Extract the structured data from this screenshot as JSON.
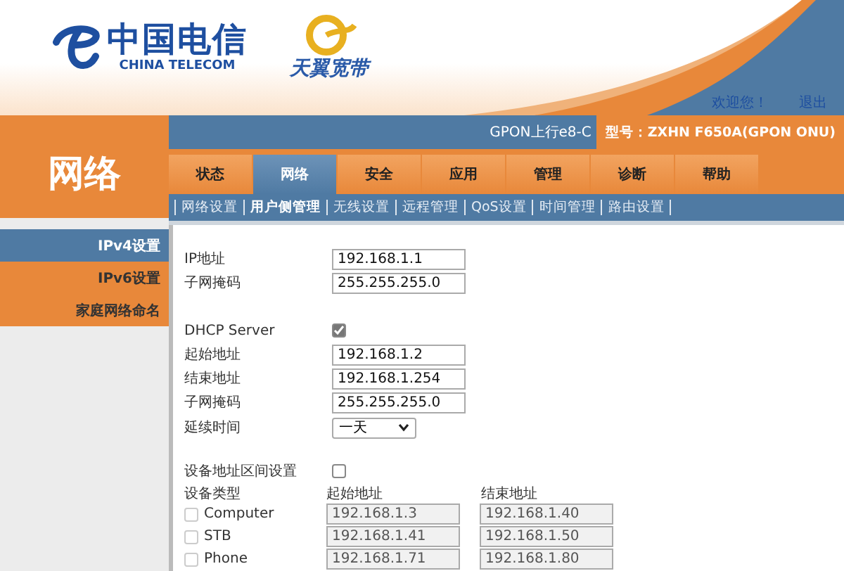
{
  "header": {
    "brand_chinese": "中国电信",
    "brand_english": "CHINA TELECOM",
    "product": "天翼宽带",
    "links": [
      "欢迎您！",
      "退出"
    ]
  },
  "info_bar": {
    "connection": "GPON上行e8-C",
    "model": "型号：ZXHN F650A(GPON ONU)"
  },
  "section_title": "网络",
  "tabs": [
    {
      "label": "状态",
      "selected": false
    },
    {
      "label": "网络",
      "selected": true
    },
    {
      "label": "安全",
      "selected": false
    },
    {
      "label": "应用",
      "selected": false
    },
    {
      "label": "管理",
      "selected": false
    },
    {
      "label": "诊断",
      "selected": false
    },
    {
      "label": "帮助",
      "selected": false
    }
  ],
  "sub_tabs": [
    {
      "label": "网络设置",
      "selected": false
    },
    {
      "label": "用户侧管理",
      "selected": true
    },
    {
      "label": "无线设置",
      "selected": false
    },
    {
      "label": "远程管理",
      "selected": false
    },
    {
      "label": "QoS设置",
      "selected": false
    },
    {
      "label": "时间管理",
      "selected": false
    },
    {
      "label": "路由设置",
      "selected": false
    }
  ],
  "sidebar": [
    {
      "label": "IPv4设置",
      "selected": true
    },
    {
      "label": "IPv6设置",
      "selected": false
    },
    {
      "label": "家庭网络命名",
      "selected": false
    }
  ],
  "form": {
    "lan_fields": [
      {
        "label": "IP地址",
        "value": "192.168.1.1"
      },
      {
        "label": "子网掩码",
        "value": "255.255.255.0"
      }
    ],
    "dhcp": {
      "label": "DHCP Server",
      "checked": true
    },
    "dhcp_fields": [
      {
        "label": "起始地址",
        "value": "192.168.1.2"
      },
      {
        "label": "结束地址",
        "value": "192.168.1.254"
      },
      {
        "label": "子网掩码",
        "value": "255.255.255.0"
      }
    ],
    "lease": {
      "label": "延续时间",
      "value": "一天"
    },
    "range_toggle": {
      "label": "设备地址区间设置",
      "checked": false
    },
    "range_table": {
      "columns": [
        "设备类型",
        "起始地址",
        "结束地址"
      ],
      "rows": [
        {
          "device": "Computer",
          "checked": false,
          "disabled": true,
          "start": "192.168.1.3",
          "end": "192.168.1.40"
        },
        {
          "device": "STB",
          "checked": false,
          "disabled": true,
          "start": "192.168.1.41",
          "end": "192.168.1.50"
        },
        {
          "device": "Phone",
          "checked": false,
          "disabled": true,
          "start": "192.168.1.71",
          "end": "192.168.1.80"
        }
      ]
    }
  }
}
